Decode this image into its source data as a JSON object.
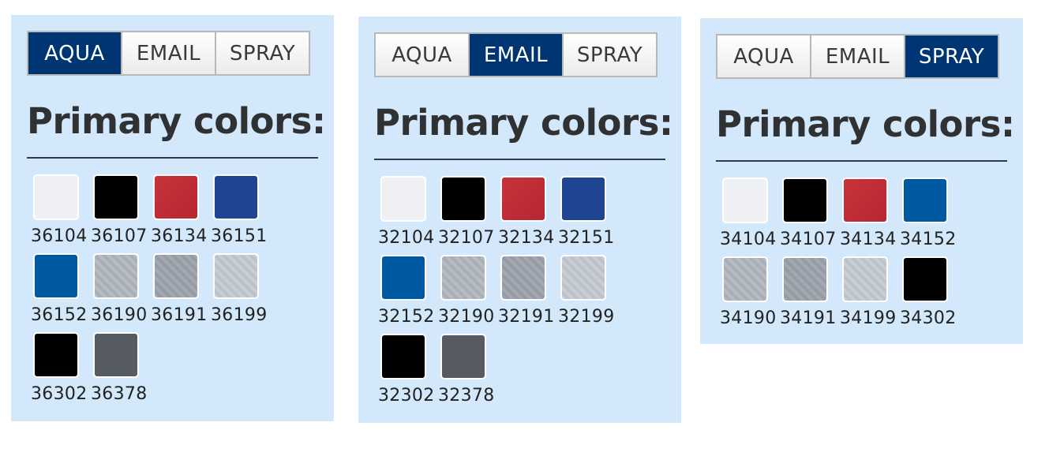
{
  "panels": [
    {
      "tabs": [
        {
          "label": "AQUA",
          "active": true
        },
        {
          "label": "EMAIL",
          "active": false
        },
        {
          "label": "SPRAY",
          "active": false
        }
      ],
      "heading": "Primary colors:",
      "swatches": [
        {
          "code": "36104",
          "color": "white"
        },
        {
          "code": "36107",
          "color": "black"
        },
        {
          "code": "36134",
          "color": "red"
        },
        {
          "code": "36151",
          "color": "blue"
        },
        {
          "code": "36152",
          "color": "ocean"
        },
        {
          "code": "36190",
          "color": "silver1"
        },
        {
          "code": "36191",
          "color": "silver2"
        },
        {
          "code": "36199",
          "color": "silver3"
        },
        {
          "code": "36302",
          "color": "black"
        },
        {
          "code": "36378",
          "color": "graphite"
        }
      ]
    },
    {
      "tabs": [
        {
          "label": "AQUA",
          "active": false
        },
        {
          "label": "EMAIL",
          "active": true
        },
        {
          "label": "SPRAY",
          "active": false
        }
      ],
      "heading": "Primary colors:",
      "swatches": [
        {
          "code": "32104",
          "color": "white"
        },
        {
          "code": "32107",
          "color": "black"
        },
        {
          "code": "32134",
          "color": "red"
        },
        {
          "code": "32151",
          "color": "blue"
        },
        {
          "code": "32152",
          "color": "ocean"
        },
        {
          "code": "32190",
          "color": "silver1"
        },
        {
          "code": "32191",
          "color": "silver2"
        },
        {
          "code": "32199",
          "color": "silver3"
        },
        {
          "code": "32302",
          "color": "black"
        },
        {
          "code": "32378",
          "color": "graphite"
        }
      ]
    },
    {
      "tabs": [
        {
          "label": "AQUA",
          "active": false
        },
        {
          "label": "EMAIL",
          "active": false
        },
        {
          "label": "SPRAY",
          "active": true
        }
      ],
      "heading": "Primary colors:",
      "swatches": [
        {
          "code": "34104",
          "color": "white"
        },
        {
          "code": "34107",
          "color": "black"
        },
        {
          "code": "34134",
          "color": "red"
        },
        {
          "code": "34152",
          "color": "ocean"
        },
        {
          "code": "34190",
          "color": "silver1"
        },
        {
          "code": "34191",
          "color": "silver2"
        },
        {
          "code": "34199",
          "color": "silver3"
        },
        {
          "code": "34302",
          "color": "black"
        }
      ]
    }
  ]
}
